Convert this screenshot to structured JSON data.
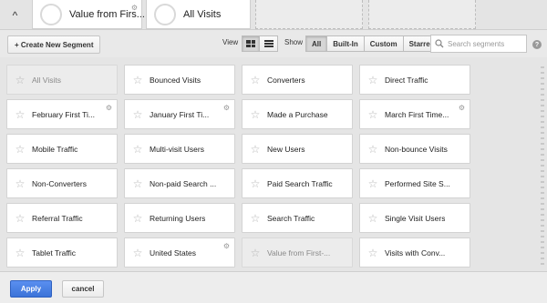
{
  "selected_segments": [
    {
      "name": "Value from Firs...",
      "has_gear": true
    },
    {
      "name": "All Visits",
      "has_gear": false
    }
  ],
  "toolbar": {
    "create_label": "+ Create New Segment",
    "view_label": "View",
    "show_label": "Show",
    "show_filters": [
      "All",
      "Built-In",
      "Custom",
      "Starred"
    ],
    "active_filter": "All",
    "search_placeholder": "Search segments"
  },
  "segments_grid": [
    [
      {
        "name": "All Visits",
        "disabled": true,
        "gear": false
      },
      {
        "name": "Bounced Visits",
        "gear": false
      },
      {
        "name": "Converters",
        "gear": false
      },
      {
        "name": "Direct Traffic",
        "gear": false
      }
    ],
    [
      {
        "name": "February First Ti...",
        "gear": true
      },
      {
        "name": "January First Ti...",
        "gear": true
      },
      {
        "name": "Made a Purchase",
        "gear": false
      },
      {
        "name": "March First Time...",
        "gear": true
      }
    ],
    [
      {
        "name": "Mobile Traffic",
        "gear": false
      },
      {
        "name": "Multi-visit Users",
        "gear": false
      },
      {
        "name": "New Users",
        "gear": false
      },
      {
        "name": "Non-bounce Visits",
        "gear": false
      }
    ],
    [
      {
        "name": "Non-Converters",
        "gear": false
      },
      {
        "name": "Non-paid Search ...",
        "gear": false
      },
      {
        "name": "Paid Search Traffic",
        "gear": false
      },
      {
        "name": "Performed Site S...",
        "gear": false
      }
    ],
    [
      {
        "name": "Referral Traffic",
        "gear": false
      },
      {
        "name": "Returning Users",
        "gear": false
      },
      {
        "name": "Search Traffic",
        "gear": false
      },
      {
        "name": "Single Visit Users",
        "gear": false
      }
    ],
    [
      {
        "name": "Tablet Traffic",
        "gear": false
      },
      {
        "name": "United States",
        "gear": true
      },
      {
        "name": "Value from First-...",
        "disabled": true,
        "gear": false
      },
      {
        "name": "Visits with Conv...",
        "gear": false
      }
    ]
  ],
  "footer": {
    "apply_label": "Apply",
    "cancel_label": "cancel"
  },
  "colors": {
    "apply_blue": "#3b73d8",
    "star_gray": "#b5b5b5"
  }
}
